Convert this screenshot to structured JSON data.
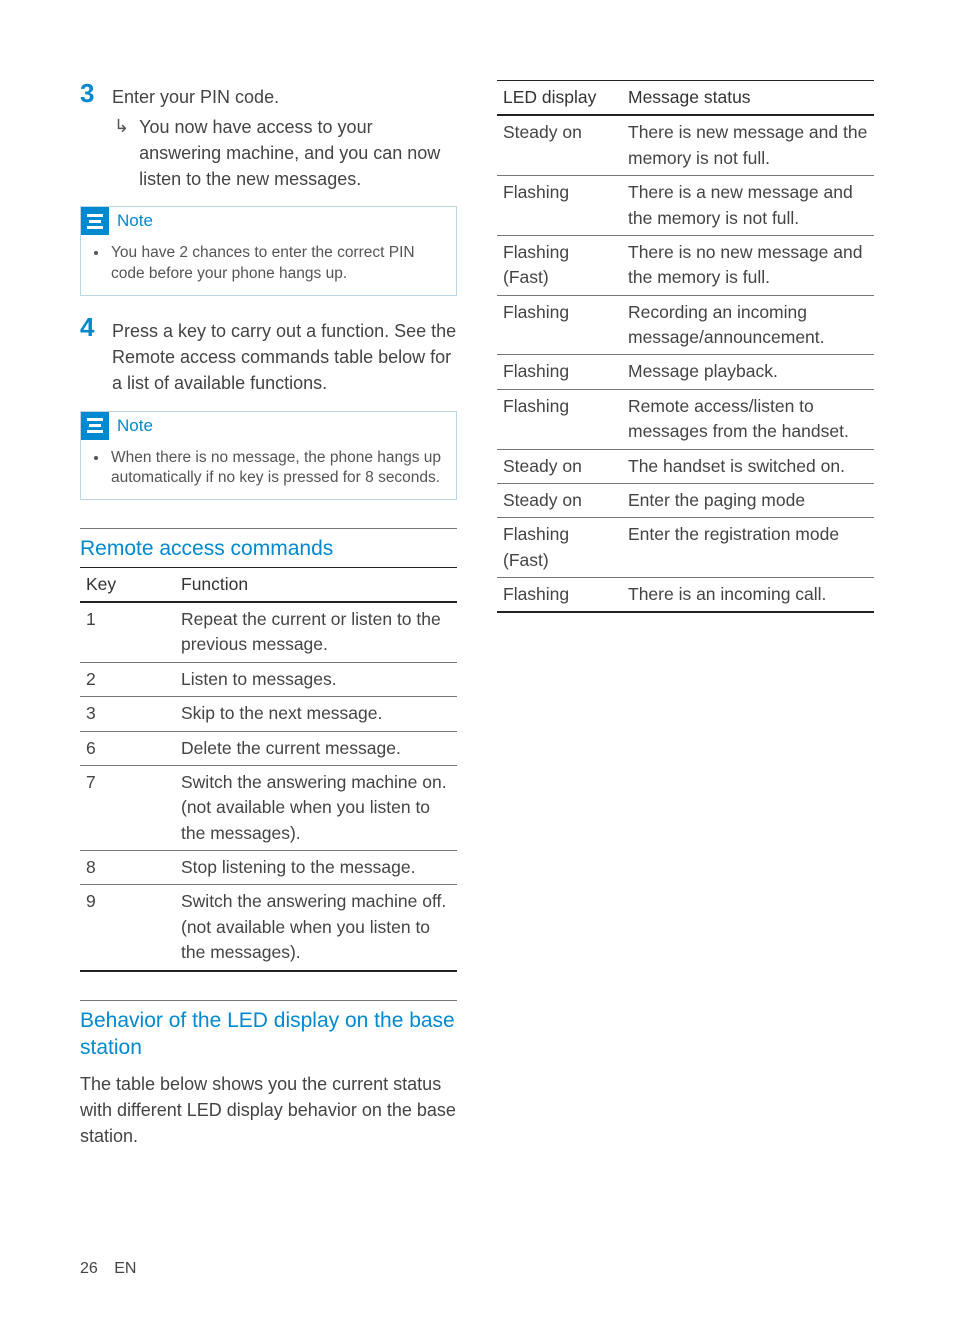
{
  "steps": {
    "s3": {
      "num": "3",
      "text": "Enter your PIN code.",
      "sub": "You now have access to your answering machine, and you can now listen to the new messages."
    },
    "s4": {
      "num": "4",
      "text": "Press a key to carry out a function. See the Remote access commands table below for a list of available functions."
    }
  },
  "notes": {
    "title": "Note",
    "n1": "You have 2 chances to enter the correct PIN code before your phone hangs up.",
    "n2": "When there is no message, the phone hangs up automatically if no key is pressed for 8 seconds."
  },
  "remote": {
    "title": "Remote access commands",
    "head_key": "Key",
    "head_func": "Function",
    "rows": [
      {
        "k": "1",
        "f": "Repeat the current or listen to the previous message."
      },
      {
        "k": "2",
        "f": "Listen to messages."
      },
      {
        "k": "3",
        "f": "Skip to the next message."
      },
      {
        "k": "6",
        "f": "Delete the current message."
      },
      {
        "k": "7",
        "f": "Switch the answering machine on.\n(not available when you listen to the messages)."
      },
      {
        "k": "8",
        "f": "Stop listening to the message."
      },
      {
        "k": "9",
        "f": "Switch the answering machine off.\n(not available when you listen to the messages)."
      }
    ]
  },
  "behavior": {
    "title": "Behavior of the LED display on the base station",
    "intro": "The table below shows you the current status with different LED display behavior on the base station."
  },
  "led": {
    "head_disp": "LED display",
    "head_msg": "Message status",
    "rows": [
      {
        "d": "Steady on",
        "m": "There is new message and the memory is not full."
      },
      {
        "d": "Flashing",
        "m": "There is a new message and the memory is not full."
      },
      {
        "d": "Flashing (Fast)",
        "m": "There is no new message and the memory is full."
      },
      {
        "d": "Flashing",
        "m": "Recording an incoming message/announcement."
      },
      {
        "d": "Flashing",
        "m": "Message playback."
      },
      {
        "d": "Flashing",
        "m": "Remote access/listen to messages from the handset."
      },
      {
        "d": "Steady on",
        "m": "The handset is switched on."
      },
      {
        "d": "Steady on",
        "m": "Enter the paging mode"
      },
      {
        "d": "Flashing (Fast)",
        "m": "Enter the registration mode"
      },
      {
        "d": "Flashing",
        "m": "There is an incoming call."
      }
    ]
  },
  "footer": {
    "page": "26",
    "lang": "EN"
  }
}
